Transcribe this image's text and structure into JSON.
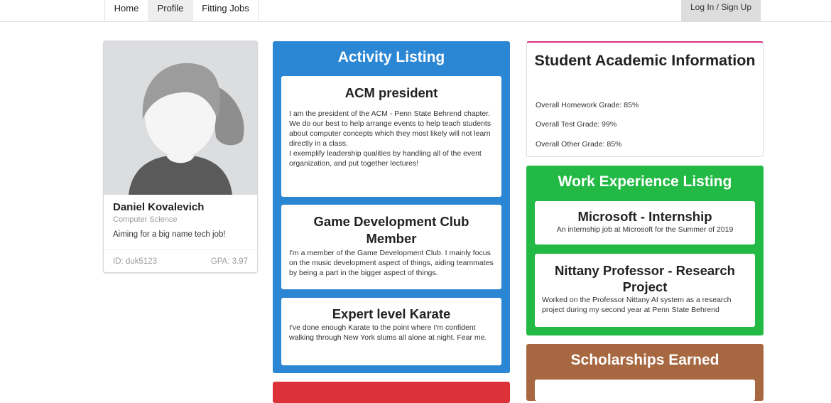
{
  "nav": {
    "tabs": [
      {
        "label": "Home"
      },
      {
        "label": "Profile"
      },
      {
        "label": "Fitting Jobs"
      }
    ],
    "login_label": "Log In / Sign Up"
  },
  "profile": {
    "name": "Daniel Kovalevich",
    "major": "Computer Science",
    "bio": "Aiming for a big name tech job!",
    "id": "ID: duk5123",
    "gpa": "GPA: 3.97"
  },
  "activities": {
    "title": "Activity Listing",
    "items": [
      {
        "title": "ACM president",
        "lines": [
          "I am the president of the ACM - Penn State Behrend chapter.",
          "We do our best to help arrange events to help teach students about computer concepts which they most likely will not learn directly in a class.",
          "I exemplify leadership qualities by handling all of the event organization, and put together lectures!"
        ]
      },
      {
        "title": "Game Development Club Member",
        "text": "I'm a member of the Game Development Club. I mainly focus on the music development aspect of things, aiding teammates by being a part in the bigger aspect of things."
      },
      {
        "title": "Expert level Karate",
        "text": "I've done enough Karate to the point where I'm confident walking through New York slums all alone at night. Fear me."
      }
    ]
  },
  "academic": {
    "title": "Student Academic Information",
    "homework": "Overall Homework Grade: 85%",
    "test": "Overall Test Grade: 99%",
    "other": "Overall Other Grade: 85%"
  },
  "work": {
    "title": "Work Experience Listing",
    "items": [
      {
        "title": "Microsoft - Internship",
        "text": "An internship job at Microsoft for the Summer of 2019"
      },
      {
        "title": "Nittany Professor - Research Project",
        "text": "Worked on the Professor Nittany AI system as a research project during my second year at Penn State Behrend"
      }
    ]
  },
  "scholarships": {
    "title": "Scholarships Earned"
  },
  "colors": {
    "activity_panel": "#2b86d4",
    "work_panel": "#22b944",
    "scholarship_panel": "#a76841",
    "fourth_panel": "#dc3139",
    "academic_accent": "#d63384"
  }
}
